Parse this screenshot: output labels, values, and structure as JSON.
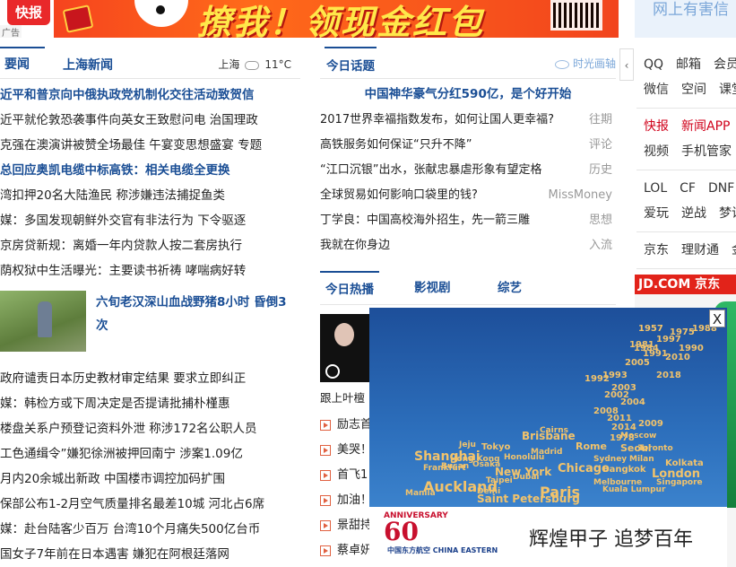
{
  "banner": {
    "logo_text": "快报",
    "slogan": "撩我！领现金红包",
    "ad_tag": "广告"
  },
  "right_top": {
    "text": "网上有害信"
  },
  "left": {
    "tabs": [
      {
        "label": "要闻"
      },
      {
        "label": "上海新闻"
      }
    ],
    "weather": {
      "city": "上海",
      "temp": "11°C"
    },
    "news": [
      {
        "text": "近平和普京向中俄执政党机制化交往活动致贺信",
        "hl": true
      },
      {
        "text": "近平就伦敦恐袭事件向英女王致慰问电 治国理政",
        "hl": false
      },
      {
        "text": "克强在澳演讲被赞全场最佳 午宴变思想盛宴 专题",
        "hl": false
      },
      {
        "text": "总回应奥凯电缆中标高铁：相关电缆全更换",
        "hl": true
      },
      {
        "text": "湾扣押20名大陆渔民 称涉嫌违法捕捉鱼类",
        "hl": false
      },
      {
        "text": "媒：多国发现朝鲜外交官有非法行为 下令驱逐",
        "hl": false
      },
      {
        "text": "京房贷新规：离婚一年内贷款人按二套房执行",
        "hl": false
      },
      {
        "text": "荫权狱中生活曝光：主要读书祈祷 哮喘病好转",
        "hl": false
      }
    ],
    "feature": {
      "text": "六旬老汉深山血战野猪8小时 昏倒3次"
    },
    "news2": [
      {
        "text": "政府谴责日本历史教材审定结果 要求立即纠正"
      },
      {
        "text": "媒：韩检方或下周决定是否提请批捕朴槿惠"
      },
      {
        "text": "楼盘关系户预登记资料外泄 称涉172名公职人员"
      },
      {
        "text": "工色通缉令”嫌犯徐洲被押回南宁 涉案1.09亿"
      },
      {
        "text": "月内20余城出新政 中国楼市调控加码扩围"
      },
      {
        "text": "保部公布1-2月空气质量排名最差10城 河北占6席"
      },
      {
        "text": "媒：赴台陆客少百万 台湾10个月痛失500亿台币"
      },
      {
        "text": "国女子7年前在日本遇害 嫌犯在阿根廷落网"
      }
    ]
  },
  "middle": {
    "header": "今日话题",
    "shiguang": "时光画轴",
    "top_line": "中国神华豪气分红590亿，是个好开始",
    "topics": [
      {
        "text": "2017世界幸福指数发布，如何让国人更幸福?",
        "cat": "往期"
      },
      {
        "text": "高铁服务如何保证“只升不降”",
        "cat": "评论"
      },
      {
        "text": "“江口沉银”出水，张献忠暴虐形象有望定格",
        "cat": "历史"
      },
      {
        "text": "全球贸易如何影响口袋里的钱?",
        "cat": "MissMoney"
      },
      {
        "text": "丁学良：中国高校海外招生，先一箭三雕",
        "cat": "思想"
      },
      {
        "text": "我就在你身边",
        "cat": "入流"
      }
    ],
    "tabs": [
      {
        "label": "今日热播"
      },
      {
        "label": "影视剧"
      },
      {
        "label": "综艺"
      }
    ],
    "video_caption": "跟上叶檀",
    "hot": [
      "励志首",
      "美哭！",
      "首飞1",
      "加油！",
      "景甜持",
      "蔡卓妍"
    ]
  },
  "right": {
    "groups": [
      {
        "rows": [
          [
            {
              "t": "QQ"
            },
            {
              "t": "邮箱"
            },
            {
              "t": "会员"
            }
          ],
          [
            {
              "t": "微信"
            },
            {
              "t": "空间"
            },
            {
              "t": "课堂"
            }
          ]
        ]
      },
      {
        "rows": [
          [
            {
              "t": "快报",
              "red": true
            },
            {
              "t": "新闻APP",
              "red": true
            }
          ],
          [
            {
              "t": "视频"
            },
            {
              "t": "手机管家"
            }
          ]
        ]
      },
      {
        "rows": [
          [
            {
              "t": "LOL"
            },
            {
              "t": "CF"
            },
            {
              "t": "DNF"
            }
          ],
          [
            {
              "t": "爱玩"
            },
            {
              "t": "逆战"
            },
            {
              "t": "梦诛"
            }
          ]
        ]
      },
      {
        "rows": [
          [
            {
              "t": "京东"
            },
            {
              "t": "理财通"
            },
            {
              "t": "金"
            }
          ]
        ]
      }
    ],
    "jd_label": "JD.COM 京东"
  },
  "popup": {
    "close": "X",
    "anniversary": "ANNIVERSARY",
    "sixty": "60",
    "airline": "中国东方航空 CHINA EASTERN",
    "slogan": "辉煌甲子  追梦百年",
    "cities": [
      "Brisbane",
      "Tokyo",
      "Shanghai",
      "Rome",
      "Chicago",
      "Seoul",
      "London",
      "New York",
      "Paris",
      "Auckland",
      "Saint Petersburg",
      "Jeju",
      "Bangkok",
      "Honolulu",
      "Singapore",
      "Milan",
      "Osaka",
      "Toronto",
      "Busan",
      "Kolkata",
      "Taipei",
      "Madrid",
      "Dubai",
      "Frankfurt",
      "Cairns",
      "Hong Kong",
      "Sydney",
      "Melbourne",
      "Kuala Lumpur",
      "Moscow",
      "Delhi",
      "Manila"
    ],
    "years": [
      "1957",
      "1975",
      "1988",
      "1997",
      "1981",
      "1991",
      "2005",
      "2010",
      "1993",
      "1992",
      "2003",
      "2002",
      "2004",
      "2008",
      "2011",
      "2014",
      "1984",
      "2018",
      "1978",
      "2009",
      "1990"
    ]
  }
}
